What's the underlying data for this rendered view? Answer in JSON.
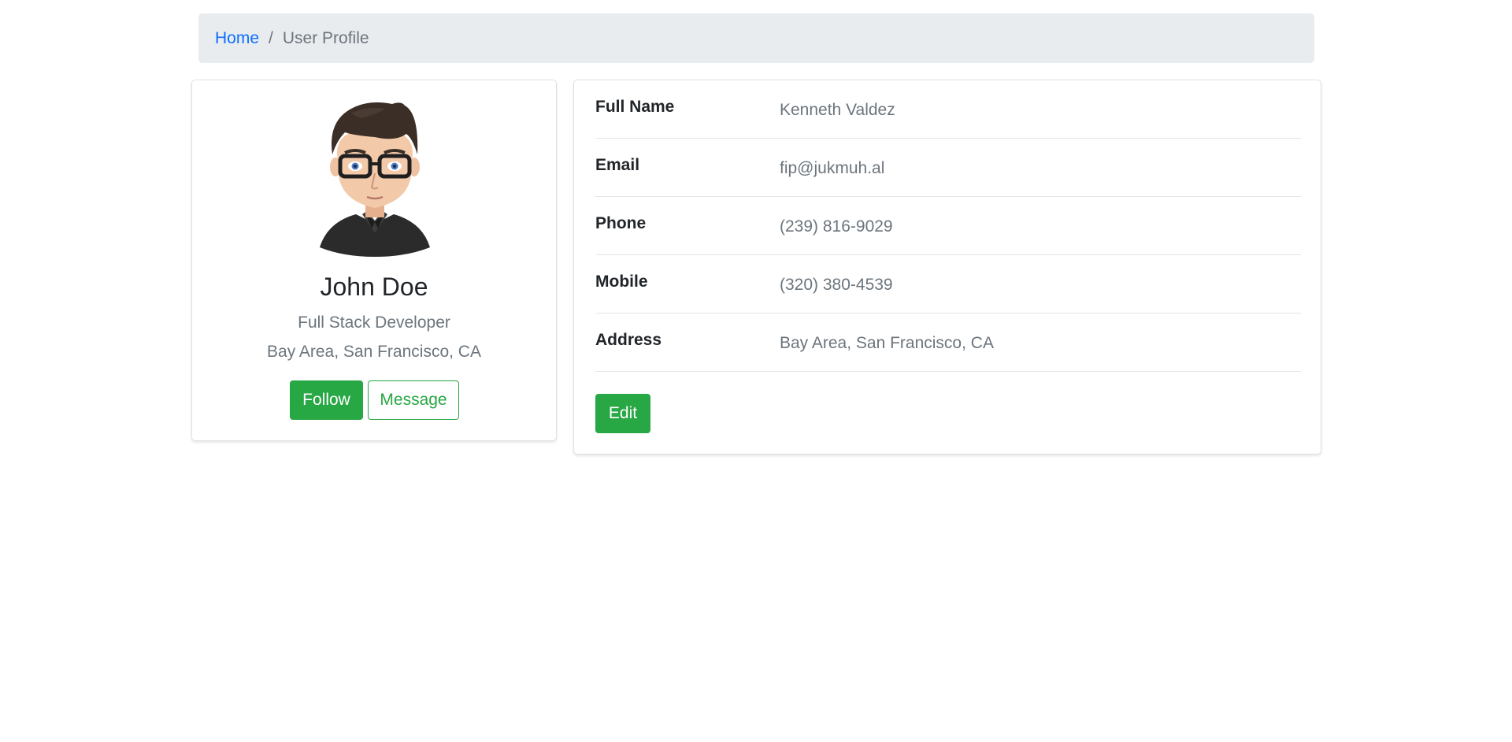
{
  "breadcrumb": {
    "home": "Home",
    "separator": "/",
    "current": "User Profile"
  },
  "profile": {
    "avatar_icon": "avatar-illustration",
    "name": "John Doe",
    "title": "Full Stack Developer",
    "location": "Bay Area, San Francisco, CA",
    "follow_label": "Follow",
    "message_label": "Message"
  },
  "details": {
    "rows": [
      {
        "label": "Full Name",
        "value": "Kenneth Valdez"
      },
      {
        "label": "Email",
        "value": "fip@jukmuh.al"
      },
      {
        "label": "Phone",
        "value": "(239) 816-9029"
      },
      {
        "label": "Mobile",
        "value": "(320) 380-4539"
      },
      {
        "label": "Address",
        "value": "Bay Area, San Francisco, CA"
      }
    ],
    "edit_label": "Edit"
  },
  "colors": {
    "accent_green": "#28a745",
    "link_blue": "#0d6efd",
    "breadcrumb_bg": "#e9ecef",
    "muted_text": "#6c757d"
  }
}
